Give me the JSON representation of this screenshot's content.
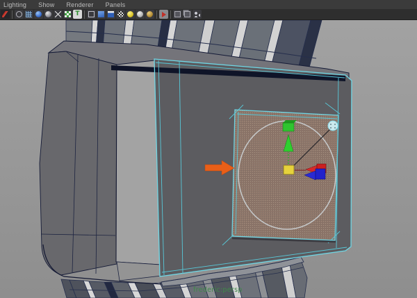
{
  "menu_bar": {
    "items": [
      {
        "label": "Lighting"
      },
      {
        "label": "Show"
      },
      {
        "label": "Renderer"
      },
      {
        "label": "Panels"
      }
    ]
  },
  "toolbar": {
    "icons": [
      {
        "name": "camera-select-icon",
        "cls": "i1"
      },
      {
        "name": "wireframe-display-icon",
        "cls": "i2"
      },
      {
        "name": "grid-display-icon",
        "cls": "i3"
      },
      {
        "name": "shaded-display-icon",
        "cls": "i4"
      },
      {
        "name": "textured-display-icon",
        "cls": "i5"
      },
      {
        "name": "default-material-icon",
        "cls": "i6"
      },
      {
        "name": "checker-texture-icon",
        "cls": "i7"
      },
      {
        "name": "texture-editor-icon",
        "cls": "i8"
      },
      {
        "name": "bounding-box-icon",
        "cls": "i9"
      },
      {
        "name": "shaded-cube-icon",
        "cls": "i10"
      },
      {
        "name": "textured-cube-icon",
        "cls": "i11"
      },
      {
        "name": "dither-icon",
        "cls": "i12"
      },
      {
        "name": "all-lights-icon",
        "cls": "i13"
      },
      {
        "name": "default-light-icon",
        "cls": "i14"
      },
      {
        "name": "ambient-light-icon",
        "cls": "i15"
      },
      {
        "name": "isolate-select-icon",
        "cls": "i16"
      },
      {
        "name": "scene-object-icon",
        "cls": "i17"
      },
      {
        "name": "frame-object-icon",
        "cls": "i18"
      },
      {
        "name": "hypergraph-icon",
        "cls": "i19"
      }
    ],
    "separators_after": [
      0,
      7,
      14,
      15
    ]
  },
  "viewport": {
    "camera_label": "frederic:persp",
    "background_color": "#9b9b9b",
    "wireframe_color": "#1c2340",
    "selected_wireframe_color": "#6fd6e4",
    "selected_face_color": "#8c7468",
    "hud_text_color": "#3e8a49",
    "objects": [
      "watch-case",
      "watch-strap-top",
      "watch-strap-bottom",
      "selected-panel",
      "circular-edge-loop"
    ]
  },
  "annotation": {
    "arrow_color": "#e95f18",
    "arrow_direction": "right"
  },
  "manipulator": {
    "type": "extrude-move-manipulator",
    "axis_x_color": "#cc2222",
    "axis_y_color": "#2fc42f",
    "axis_z_color": "#2222cc",
    "center_color": "#e6d23c"
  }
}
